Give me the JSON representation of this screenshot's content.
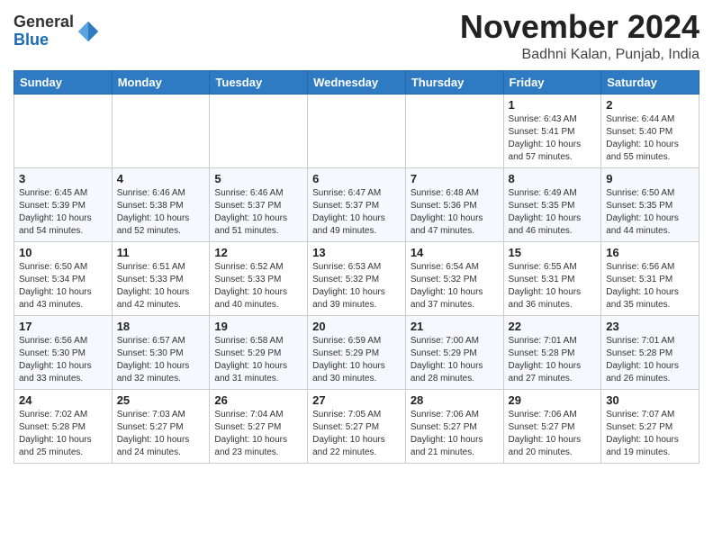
{
  "header": {
    "logo": {
      "line1": "General",
      "line2": "Blue"
    },
    "month_title": "November 2024",
    "location": "Badhni Kalan, Punjab, India"
  },
  "weekdays": [
    "Sunday",
    "Monday",
    "Tuesday",
    "Wednesday",
    "Thursday",
    "Friday",
    "Saturday"
  ],
  "weeks": [
    [
      {
        "day": "",
        "info": ""
      },
      {
        "day": "",
        "info": ""
      },
      {
        "day": "",
        "info": ""
      },
      {
        "day": "",
        "info": ""
      },
      {
        "day": "",
        "info": ""
      },
      {
        "day": "1",
        "info": "Sunrise: 6:43 AM\nSunset: 5:41 PM\nDaylight: 10 hours\nand 57 minutes."
      },
      {
        "day": "2",
        "info": "Sunrise: 6:44 AM\nSunset: 5:40 PM\nDaylight: 10 hours\nand 55 minutes."
      }
    ],
    [
      {
        "day": "3",
        "info": "Sunrise: 6:45 AM\nSunset: 5:39 PM\nDaylight: 10 hours\nand 54 minutes."
      },
      {
        "day": "4",
        "info": "Sunrise: 6:46 AM\nSunset: 5:38 PM\nDaylight: 10 hours\nand 52 minutes."
      },
      {
        "day": "5",
        "info": "Sunrise: 6:46 AM\nSunset: 5:37 PM\nDaylight: 10 hours\nand 51 minutes."
      },
      {
        "day": "6",
        "info": "Sunrise: 6:47 AM\nSunset: 5:37 PM\nDaylight: 10 hours\nand 49 minutes."
      },
      {
        "day": "7",
        "info": "Sunrise: 6:48 AM\nSunset: 5:36 PM\nDaylight: 10 hours\nand 47 minutes."
      },
      {
        "day": "8",
        "info": "Sunrise: 6:49 AM\nSunset: 5:35 PM\nDaylight: 10 hours\nand 46 minutes."
      },
      {
        "day": "9",
        "info": "Sunrise: 6:50 AM\nSunset: 5:35 PM\nDaylight: 10 hours\nand 44 minutes."
      }
    ],
    [
      {
        "day": "10",
        "info": "Sunrise: 6:50 AM\nSunset: 5:34 PM\nDaylight: 10 hours\nand 43 minutes."
      },
      {
        "day": "11",
        "info": "Sunrise: 6:51 AM\nSunset: 5:33 PM\nDaylight: 10 hours\nand 42 minutes."
      },
      {
        "day": "12",
        "info": "Sunrise: 6:52 AM\nSunset: 5:33 PM\nDaylight: 10 hours\nand 40 minutes."
      },
      {
        "day": "13",
        "info": "Sunrise: 6:53 AM\nSunset: 5:32 PM\nDaylight: 10 hours\nand 39 minutes."
      },
      {
        "day": "14",
        "info": "Sunrise: 6:54 AM\nSunset: 5:32 PM\nDaylight: 10 hours\nand 37 minutes."
      },
      {
        "day": "15",
        "info": "Sunrise: 6:55 AM\nSunset: 5:31 PM\nDaylight: 10 hours\nand 36 minutes."
      },
      {
        "day": "16",
        "info": "Sunrise: 6:56 AM\nSunset: 5:31 PM\nDaylight: 10 hours\nand 35 minutes."
      }
    ],
    [
      {
        "day": "17",
        "info": "Sunrise: 6:56 AM\nSunset: 5:30 PM\nDaylight: 10 hours\nand 33 minutes."
      },
      {
        "day": "18",
        "info": "Sunrise: 6:57 AM\nSunset: 5:30 PM\nDaylight: 10 hours\nand 32 minutes."
      },
      {
        "day": "19",
        "info": "Sunrise: 6:58 AM\nSunset: 5:29 PM\nDaylight: 10 hours\nand 31 minutes."
      },
      {
        "day": "20",
        "info": "Sunrise: 6:59 AM\nSunset: 5:29 PM\nDaylight: 10 hours\nand 30 minutes."
      },
      {
        "day": "21",
        "info": "Sunrise: 7:00 AM\nSunset: 5:29 PM\nDaylight: 10 hours\nand 28 minutes."
      },
      {
        "day": "22",
        "info": "Sunrise: 7:01 AM\nSunset: 5:28 PM\nDaylight: 10 hours\nand 27 minutes."
      },
      {
        "day": "23",
        "info": "Sunrise: 7:01 AM\nSunset: 5:28 PM\nDaylight: 10 hours\nand 26 minutes."
      }
    ],
    [
      {
        "day": "24",
        "info": "Sunrise: 7:02 AM\nSunset: 5:28 PM\nDaylight: 10 hours\nand 25 minutes."
      },
      {
        "day": "25",
        "info": "Sunrise: 7:03 AM\nSunset: 5:27 PM\nDaylight: 10 hours\nand 24 minutes."
      },
      {
        "day": "26",
        "info": "Sunrise: 7:04 AM\nSunset: 5:27 PM\nDaylight: 10 hours\nand 23 minutes."
      },
      {
        "day": "27",
        "info": "Sunrise: 7:05 AM\nSunset: 5:27 PM\nDaylight: 10 hours\nand 22 minutes."
      },
      {
        "day": "28",
        "info": "Sunrise: 7:06 AM\nSunset: 5:27 PM\nDaylight: 10 hours\nand 21 minutes."
      },
      {
        "day": "29",
        "info": "Sunrise: 7:06 AM\nSunset: 5:27 PM\nDaylight: 10 hours\nand 20 minutes."
      },
      {
        "day": "30",
        "info": "Sunrise: 7:07 AM\nSunset: 5:27 PM\nDaylight: 10 hours\nand 19 minutes."
      }
    ]
  ]
}
